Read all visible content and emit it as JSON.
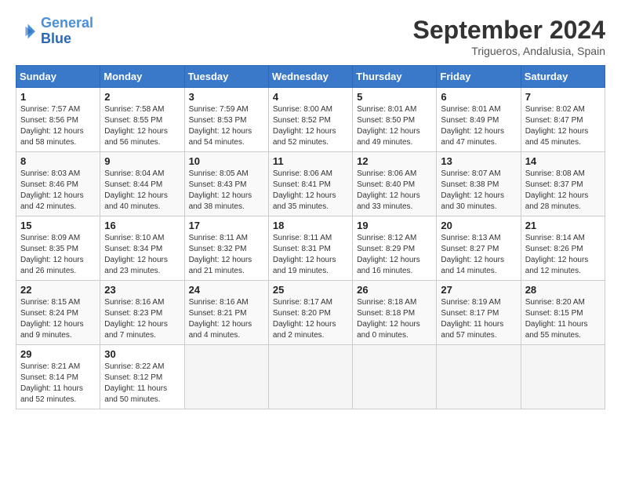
{
  "app": {
    "logo_line1": "General",
    "logo_line2": "Blue"
  },
  "calendar": {
    "title": "September 2024",
    "location": "Trigueros, Andalusia, Spain",
    "days_of_week": [
      "Sunday",
      "Monday",
      "Tuesday",
      "Wednesday",
      "Thursday",
      "Friday",
      "Saturday"
    ],
    "weeks": [
      [
        null,
        {
          "day": "2",
          "sunrise": "Sunrise: 7:58 AM",
          "sunset": "Sunset: 8:55 PM",
          "daylight": "Daylight: 12 hours and 56 minutes."
        },
        {
          "day": "3",
          "sunrise": "Sunrise: 7:59 AM",
          "sunset": "Sunset: 8:53 PM",
          "daylight": "Daylight: 12 hours and 54 minutes."
        },
        {
          "day": "4",
          "sunrise": "Sunrise: 8:00 AM",
          "sunset": "Sunset: 8:52 PM",
          "daylight": "Daylight: 12 hours and 52 minutes."
        },
        {
          "day": "5",
          "sunrise": "Sunrise: 8:01 AM",
          "sunset": "Sunset: 8:50 PM",
          "daylight": "Daylight: 12 hours and 49 minutes."
        },
        {
          "day": "6",
          "sunrise": "Sunrise: 8:01 AM",
          "sunset": "Sunset: 8:49 PM",
          "daylight": "Daylight: 12 hours and 47 minutes."
        },
        {
          "day": "7",
          "sunrise": "Sunrise: 8:02 AM",
          "sunset": "Sunset: 8:47 PM",
          "daylight": "Daylight: 12 hours and 45 minutes."
        }
      ],
      [
        {
          "day": "1",
          "sunrise": "Sunrise: 7:57 AM",
          "sunset": "Sunset: 8:56 PM",
          "daylight": "Daylight: 12 hours and 58 minutes."
        },
        null,
        null,
        null,
        null,
        null,
        null
      ],
      [
        {
          "day": "8",
          "sunrise": "Sunrise: 8:03 AM",
          "sunset": "Sunset: 8:46 PM",
          "daylight": "Daylight: 12 hours and 42 minutes."
        },
        {
          "day": "9",
          "sunrise": "Sunrise: 8:04 AM",
          "sunset": "Sunset: 8:44 PM",
          "daylight": "Daylight: 12 hours and 40 minutes."
        },
        {
          "day": "10",
          "sunrise": "Sunrise: 8:05 AM",
          "sunset": "Sunset: 8:43 PM",
          "daylight": "Daylight: 12 hours and 38 minutes."
        },
        {
          "day": "11",
          "sunrise": "Sunrise: 8:06 AM",
          "sunset": "Sunset: 8:41 PM",
          "daylight": "Daylight: 12 hours and 35 minutes."
        },
        {
          "day": "12",
          "sunrise": "Sunrise: 8:06 AM",
          "sunset": "Sunset: 8:40 PM",
          "daylight": "Daylight: 12 hours and 33 minutes."
        },
        {
          "day": "13",
          "sunrise": "Sunrise: 8:07 AM",
          "sunset": "Sunset: 8:38 PM",
          "daylight": "Daylight: 12 hours and 30 minutes."
        },
        {
          "day": "14",
          "sunrise": "Sunrise: 8:08 AM",
          "sunset": "Sunset: 8:37 PM",
          "daylight": "Daylight: 12 hours and 28 minutes."
        }
      ],
      [
        {
          "day": "15",
          "sunrise": "Sunrise: 8:09 AM",
          "sunset": "Sunset: 8:35 PM",
          "daylight": "Daylight: 12 hours and 26 minutes."
        },
        {
          "day": "16",
          "sunrise": "Sunrise: 8:10 AM",
          "sunset": "Sunset: 8:34 PM",
          "daylight": "Daylight: 12 hours and 23 minutes."
        },
        {
          "day": "17",
          "sunrise": "Sunrise: 8:11 AM",
          "sunset": "Sunset: 8:32 PM",
          "daylight": "Daylight: 12 hours and 21 minutes."
        },
        {
          "day": "18",
          "sunrise": "Sunrise: 8:11 AM",
          "sunset": "Sunset: 8:31 PM",
          "daylight": "Daylight: 12 hours and 19 minutes."
        },
        {
          "day": "19",
          "sunrise": "Sunrise: 8:12 AM",
          "sunset": "Sunset: 8:29 PM",
          "daylight": "Daylight: 12 hours and 16 minutes."
        },
        {
          "day": "20",
          "sunrise": "Sunrise: 8:13 AM",
          "sunset": "Sunset: 8:27 PM",
          "daylight": "Daylight: 12 hours and 14 minutes."
        },
        {
          "day": "21",
          "sunrise": "Sunrise: 8:14 AM",
          "sunset": "Sunset: 8:26 PM",
          "daylight": "Daylight: 12 hours and 12 minutes."
        }
      ],
      [
        {
          "day": "22",
          "sunrise": "Sunrise: 8:15 AM",
          "sunset": "Sunset: 8:24 PM",
          "daylight": "Daylight: 12 hours and 9 minutes."
        },
        {
          "day": "23",
          "sunrise": "Sunrise: 8:16 AM",
          "sunset": "Sunset: 8:23 PM",
          "daylight": "Daylight: 12 hours and 7 minutes."
        },
        {
          "day": "24",
          "sunrise": "Sunrise: 8:16 AM",
          "sunset": "Sunset: 8:21 PM",
          "daylight": "Daylight: 12 hours and 4 minutes."
        },
        {
          "day": "25",
          "sunrise": "Sunrise: 8:17 AM",
          "sunset": "Sunset: 8:20 PM",
          "daylight": "Daylight: 12 hours and 2 minutes."
        },
        {
          "day": "26",
          "sunrise": "Sunrise: 8:18 AM",
          "sunset": "Sunset: 8:18 PM",
          "daylight": "Daylight: 12 hours and 0 minutes."
        },
        {
          "day": "27",
          "sunrise": "Sunrise: 8:19 AM",
          "sunset": "Sunset: 8:17 PM",
          "daylight": "Daylight: 11 hours and 57 minutes."
        },
        {
          "day": "28",
          "sunrise": "Sunrise: 8:20 AM",
          "sunset": "Sunset: 8:15 PM",
          "daylight": "Daylight: 11 hours and 55 minutes."
        }
      ],
      [
        {
          "day": "29",
          "sunrise": "Sunrise: 8:21 AM",
          "sunset": "Sunset: 8:14 PM",
          "daylight": "Daylight: 11 hours and 52 minutes."
        },
        {
          "day": "30",
          "sunrise": "Sunrise: 8:22 AM",
          "sunset": "Sunset: 8:12 PM",
          "daylight": "Daylight: 11 hours and 50 minutes."
        },
        null,
        null,
        null,
        null,
        null
      ]
    ]
  }
}
